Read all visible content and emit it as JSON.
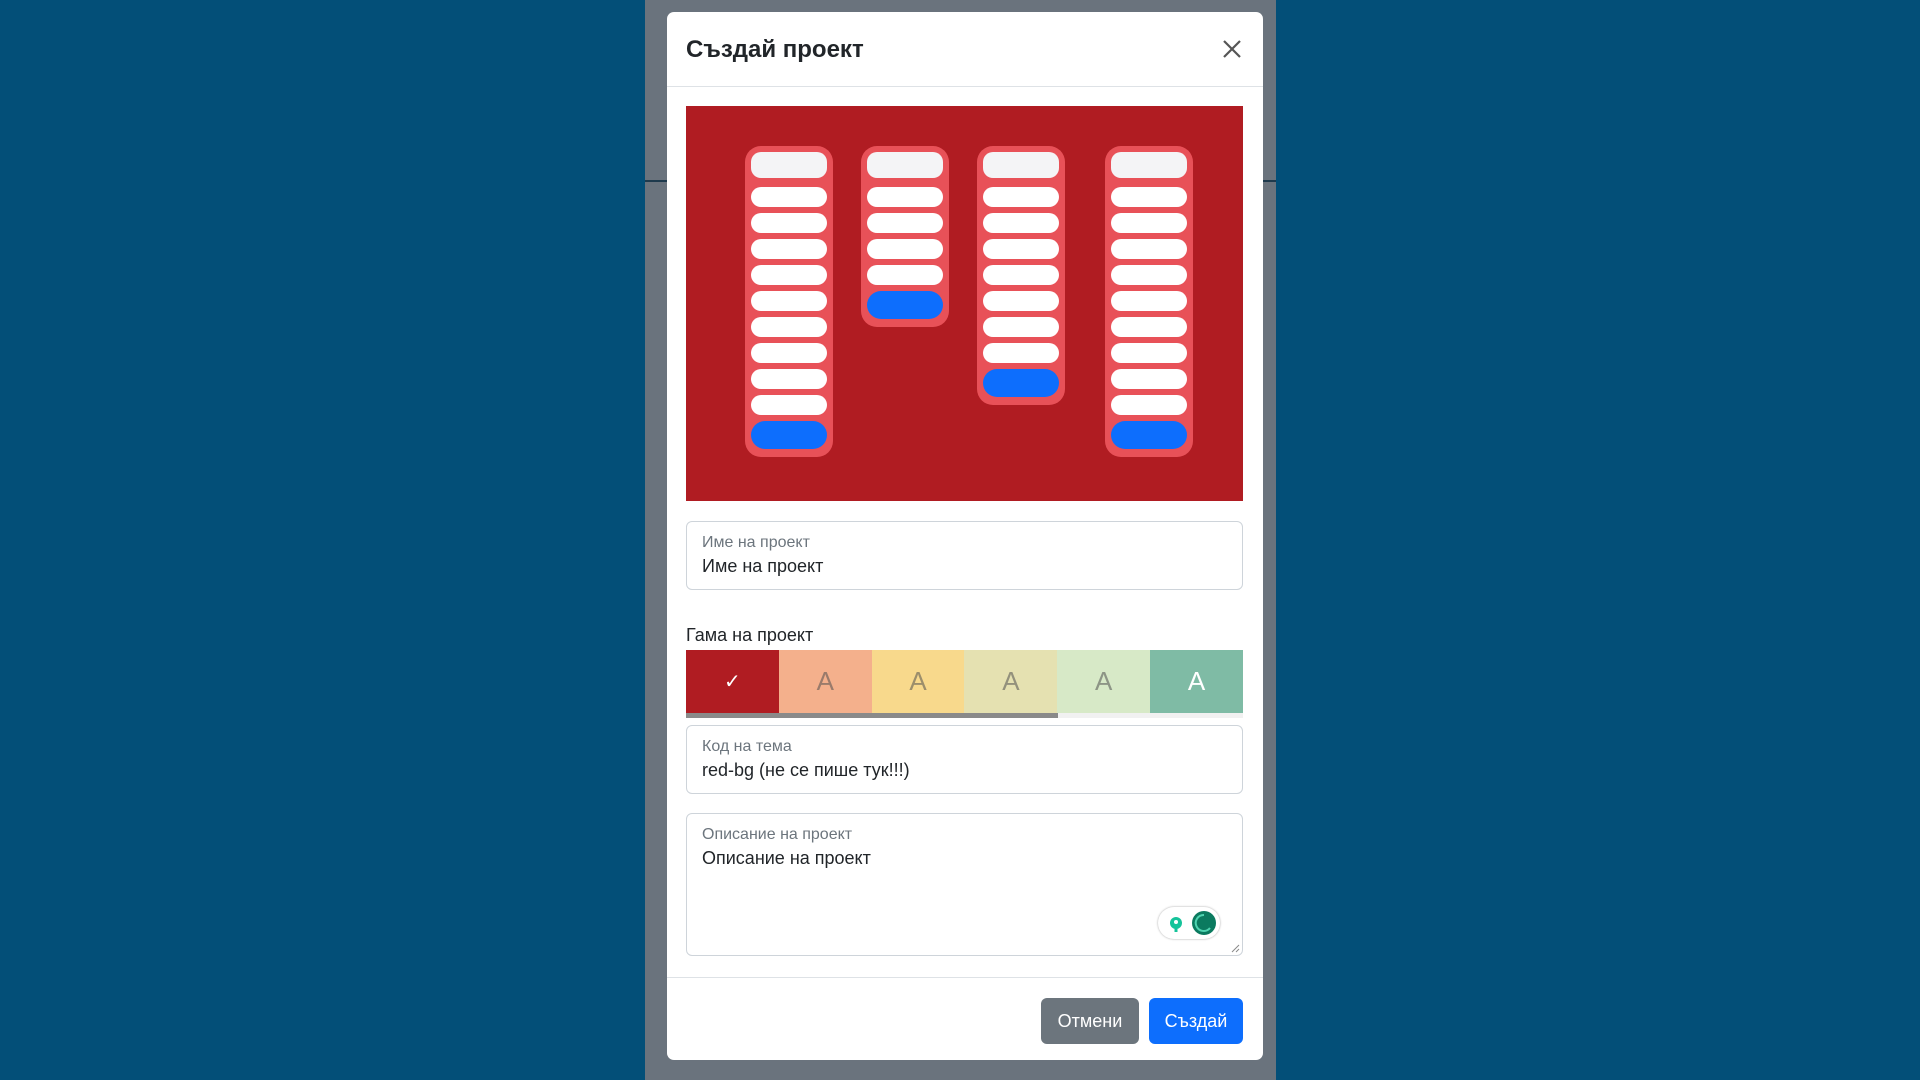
{
  "modal": {
    "title": "Създай проект",
    "close_icon": "close-icon"
  },
  "preview": {
    "background": "#b01c22",
    "column_color": "#e85158",
    "add_button_color": "#0d6efd",
    "columns": [
      {
        "cards": 10
      },
      {
        "cards": 5
      },
      {
        "cards": 8
      },
      {
        "cards": 10
      }
    ]
  },
  "project_name": {
    "label": "Име на проект",
    "value": "Име на проект"
  },
  "palette": {
    "label": "Гама на проект",
    "selected_index": 0,
    "selected_icon": "check-icon",
    "swatches": [
      {
        "color": "#b01c22",
        "letter": "✓"
      },
      {
        "color": "#f4b08c",
        "letter": "A"
      },
      {
        "color": "#f8d98c",
        "letter": "A"
      },
      {
        "color": "#e5e1b1",
        "letter": "A"
      },
      {
        "color": "#d7e9c7",
        "letter": "A"
      },
      {
        "color": "#7fbba5",
        "letter": "A"
      }
    ]
  },
  "theme_code": {
    "label": "Код на тема",
    "value": "red-bg (не се пише тук!!!)"
  },
  "description": {
    "label": "Описание на проект",
    "value": "Описание на проект"
  },
  "footer": {
    "cancel_label": "Отмени",
    "create_label": "Създай"
  }
}
